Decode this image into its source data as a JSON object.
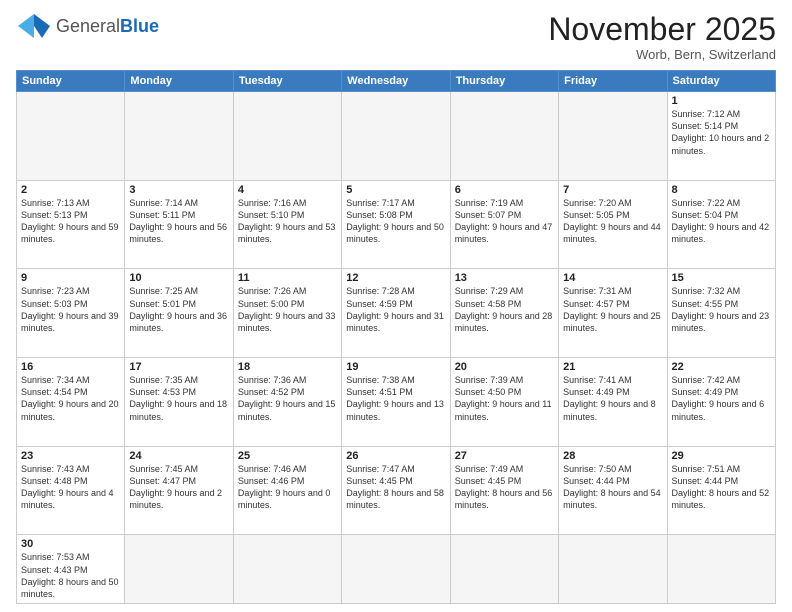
{
  "header": {
    "logo_general": "General",
    "logo_blue": "Blue",
    "month_title": "November 2025",
    "subtitle": "Worb, Bern, Switzerland"
  },
  "weekdays": [
    "Sunday",
    "Monday",
    "Tuesday",
    "Wednesday",
    "Thursday",
    "Friday",
    "Saturday"
  ],
  "weeks": [
    [
      {
        "day": "",
        "info": ""
      },
      {
        "day": "",
        "info": ""
      },
      {
        "day": "",
        "info": ""
      },
      {
        "day": "",
        "info": ""
      },
      {
        "day": "",
        "info": ""
      },
      {
        "day": "",
        "info": ""
      },
      {
        "day": "1",
        "info": "Sunrise: 7:12 AM\nSunset: 5:14 PM\nDaylight: 10 hours and 2 minutes."
      }
    ],
    [
      {
        "day": "2",
        "info": "Sunrise: 7:13 AM\nSunset: 5:13 PM\nDaylight: 9 hours and 59 minutes."
      },
      {
        "day": "3",
        "info": "Sunrise: 7:14 AM\nSunset: 5:11 PM\nDaylight: 9 hours and 56 minutes."
      },
      {
        "day": "4",
        "info": "Sunrise: 7:16 AM\nSunset: 5:10 PM\nDaylight: 9 hours and 53 minutes."
      },
      {
        "day": "5",
        "info": "Sunrise: 7:17 AM\nSunset: 5:08 PM\nDaylight: 9 hours and 50 minutes."
      },
      {
        "day": "6",
        "info": "Sunrise: 7:19 AM\nSunset: 5:07 PM\nDaylight: 9 hours and 47 minutes."
      },
      {
        "day": "7",
        "info": "Sunrise: 7:20 AM\nSunset: 5:05 PM\nDaylight: 9 hours and 44 minutes."
      },
      {
        "day": "8",
        "info": "Sunrise: 7:22 AM\nSunset: 5:04 PM\nDaylight: 9 hours and 42 minutes."
      }
    ],
    [
      {
        "day": "9",
        "info": "Sunrise: 7:23 AM\nSunset: 5:03 PM\nDaylight: 9 hours and 39 minutes."
      },
      {
        "day": "10",
        "info": "Sunrise: 7:25 AM\nSunset: 5:01 PM\nDaylight: 9 hours and 36 minutes."
      },
      {
        "day": "11",
        "info": "Sunrise: 7:26 AM\nSunset: 5:00 PM\nDaylight: 9 hours and 33 minutes."
      },
      {
        "day": "12",
        "info": "Sunrise: 7:28 AM\nSunset: 4:59 PM\nDaylight: 9 hours and 31 minutes."
      },
      {
        "day": "13",
        "info": "Sunrise: 7:29 AM\nSunset: 4:58 PM\nDaylight: 9 hours and 28 minutes."
      },
      {
        "day": "14",
        "info": "Sunrise: 7:31 AM\nSunset: 4:57 PM\nDaylight: 9 hours and 25 minutes."
      },
      {
        "day": "15",
        "info": "Sunrise: 7:32 AM\nSunset: 4:55 PM\nDaylight: 9 hours and 23 minutes."
      }
    ],
    [
      {
        "day": "16",
        "info": "Sunrise: 7:34 AM\nSunset: 4:54 PM\nDaylight: 9 hours and 20 minutes."
      },
      {
        "day": "17",
        "info": "Sunrise: 7:35 AM\nSunset: 4:53 PM\nDaylight: 9 hours and 18 minutes."
      },
      {
        "day": "18",
        "info": "Sunrise: 7:36 AM\nSunset: 4:52 PM\nDaylight: 9 hours and 15 minutes."
      },
      {
        "day": "19",
        "info": "Sunrise: 7:38 AM\nSunset: 4:51 PM\nDaylight: 9 hours and 13 minutes."
      },
      {
        "day": "20",
        "info": "Sunrise: 7:39 AM\nSunset: 4:50 PM\nDaylight: 9 hours and 11 minutes."
      },
      {
        "day": "21",
        "info": "Sunrise: 7:41 AM\nSunset: 4:49 PM\nDaylight: 9 hours and 8 minutes."
      },
      {
        "day": "22",
        "info": "Sunrise: 7:42 AM\nSunset: 4:49 PM\nDaylight: 9 hours and 6 minutes."
      }
    ],
    [
      {
        "day": "23",
        "info": "Sunrise: 7:43 AM\nSunset: 4:48 PM\nDaylight: 9 hours and 4 minutes."
      },
      {
        "day": "24",
        "info": "Sunrise: 7:45 AM\nSunset: 4:47 PM\nDaylight: 9 hours and 2 minutes."
      },
      {
        "day": "25",
        "info": "Sunrise: 7:46 AM\nSunset: 4:46 PM\nDaylight: 9 hours and 0 minutes."
      },
      {
        "day": "26",
        "info": "Sunrise: 7:47 AM\nSunset: 4:45 PM\nDaylight: 8 hours and 58 minutes."
      },
      {
        "day": "27",
        "info": "Sunrise: 7:49 AM\nSunset: 4:45 PM\nDaylight: 8 hours and 56 minutes."
      },
      {
        "day": "28",
        "info": "Sunrise: 7:50 AM\nSunset: 4:44 PM\nDaylight: 8 hours and 54 minutes."
      },
      {
        "day": "29",
        "info": "Sunrise: 7:51 AM\nSunset: 4:44 PM\nDaylight: 8 hours and 52 minutes."
      }
    ],
    [
      {
        "day": "30",
        "info": "Sunrise: 7:53 AM\nSunset: 4:43 PM\nDaylight: 8 hours and 50 minutes."
      },
      {
        "day": "",
        "info": ""
      },
      {
        "day": "",
        "info": ""
      },
      {
        "day": "",
        "info": ""
      },
      {
        "day": "",
        "info": ""
      },
      {
        "day": "",
        "info": ""
      },
      {
        "day": "",
        "info": ""
      }
    ]
  ]
}
